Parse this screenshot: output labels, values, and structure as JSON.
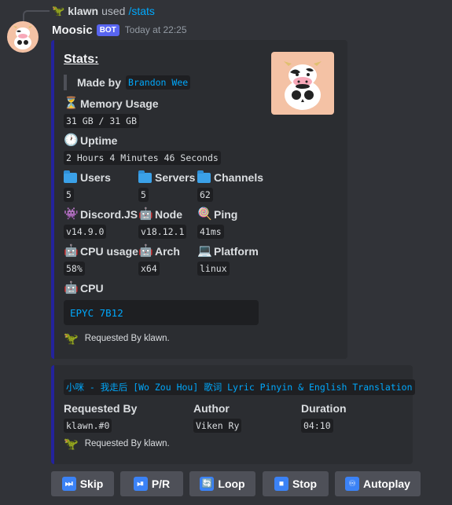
{
  "reply": {
    "icon": "dinosaur-icon",
    "username": "klawn",
    "used_text": "used",
    "command": "/stats"
  },
  "message": {
    "bot_name": "Moosic",
    "badge": "BOT",
    "timestamp": "Today at 22:25"
  },
  "stats_embed": {
    "accent_color": "#23229c",
    "title": "Stats:",
    "made_by_label": "Made by",
    "made_by_value": "Brandon Wee",
    "memory": {
      "icon": "hourglass-icon",
      "label": "Memory Usage",
      "value": "31 GB / 31 GB"
    },
    "uptime": {
      "icon": "clock-icon",
      "label": "Uptime",
      "value": "2 Hours 4 Minutes 46 Seconds"
    },
    "users": {
      "icon": "folder-icon",
      "label": "Users",
      "value": "5"
    },
    "servers": {
      "icon": "folder-icon",
      "label": "Servers",
      "value": "5"
    },
    "channels": {
      "icon": "folder-icon",
      "label": "Channels",
      "value": "62"
    },
    "discordjs": {
      "icon": "alien-monster-icon",
      "label": "Discord.JS",
      "value": "v14.9.0"
    },
    "node": {
      "icon": "robot-icon",
      "label": "Node",
      "value": "v18.12.1"
    },
    "ping": {
      "icon": "lollipop-icon",
      "label": "Ping",
      "value": "41ms"
    },
    "cpu_usage": {
      "icon": "robot-icon",
      "label": "CPU usage",
      "value": "58%"
    },
    "arch": {
      "icon": "robot-icon",
      "label": "Arch",
      "value": "x64"
    },
    "platform": {
      "icon": "laptop-icon",
      "label": "Platform",
      "value": "linux"
    },
    "cpu": {
      "icon": "robot-icon",
      "label": "CPU",
      "value": "EPYC 7B12"
    },
    "footer": "Requested By klawn."
  },
  "song_embed": {
    "accent_color": "#23229c",
    "title": "小咪 - 我走后 [Wo Zou Hou] 歌词 Lyric Pinyin & English Translation",
    "requested_by": {
      "label": "Requested By",
      "value": "klawn.#0"
    },
    "author": {
      "label": "Author",
      "value": "Viken Ry"
    },
    "duration": {
      "label": "Duration",
      "value": "04:10"
    },
    "footer": "Requested By klawn."
  },
  "buttons": [
    {
      "icon": "skip-icon",
      "glyph": "⏭",
      "label": "Skip"
    },
    {
      "icon": "play-pause-icon",
      "glyph": "⏯",
      "label": "P/R"
    },
    {
      "icon": "loop-icon",
      "glyph": "🔄",
      "label": "Loop"
    },
    {
      "icon": "stop-icon",
      "glyph": "⏹",
      "label": "Stop"
    },
    {
      "icon": "infinity-icon",
      "glyph": "♾",
      "label": "Autoplay"
    }
  ]
}
